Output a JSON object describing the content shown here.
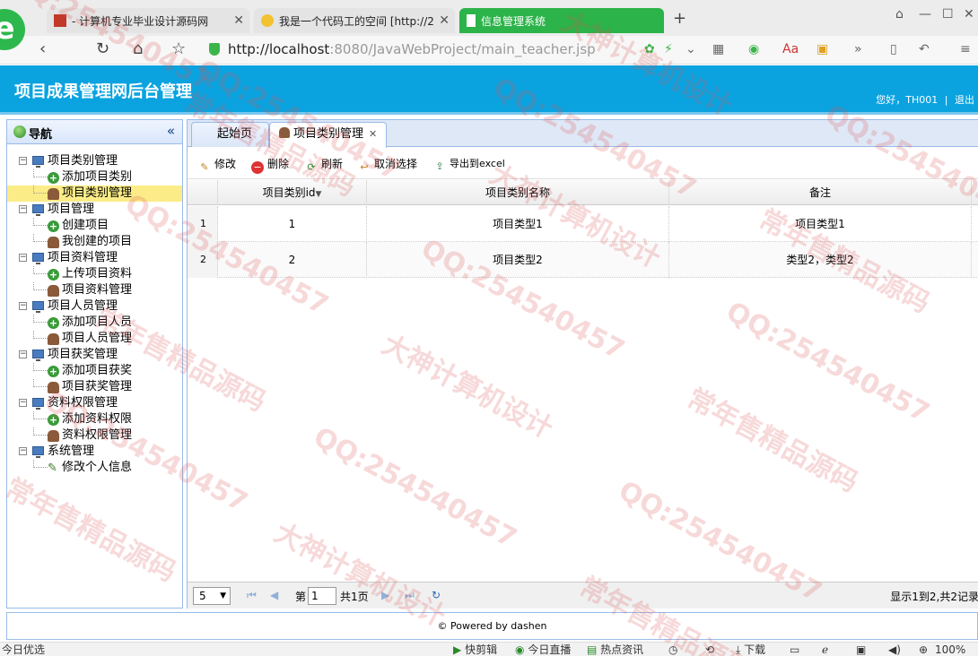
{
  "browser": {
    "tabs": [
      {
        "label": "- 计算机专业毕业设计源码网"
      },
      {
        "label": "我是一个代码工的空间 [http://2"
      },
      {
        "label": "信息管理系统"
      }
    ],
    "url_host": "http://localhost",
    "url_path": ":8080/JavaWebProject/main_teacher.jsp",
    "logo_letter": "e"
  },
  "app": {
    "title": "项目成果管理网后台管理",
    "greeting": "您好，TH001",
    "logout": "退出"
  },
  "sidebar": {
    "title": "导航",
    "groups": [
      {
        "label": "项目类别管理",
        "items": [
          "添加项目类别",
          "项目类别管理"
        ]
      },
      {
        "label": "项目管理",
        "items": [
          "创建项目",
          "我创建的项目"
        ]
      },
      {
        "label": "项目资料管理",
        "items": [
          "上传项目资料",
          "项目资料管理"
        ]
      },
      {
        "label": "项目人员管理",
        "items": [
          "添加项目人员",
          "项目人员管理"
        ]
      },
      {
        "label": "项目获奖管理",
        "items": [
          "添加项目获奖",
          "项目获奖管理"
        ]
      },
      {
        "label": "资料权限管理",
        "items": [
          "添加资料权限",
          "资料权限管理"
        ]
      },
      {
        "label": "系统管理",
        "items": [
          "修改个人信息"
        ]
      }
    ]
  },
  "panel": {
    "tabs": [
      "起始页",
      "项目类别管理"
    ],
    "toolbar": {
      "edit": "修改",
      "delete": "删除",
      "refresh": "刷新",
      "cancel_select": "取消选择",
      "export": "导出到excel"
    },
    "columns": [
      "项目类别id",
      "项目类别名称",
      "备注"
    ],
    "rows": [
      {
        "num": "1",
        "id": "1",
        "name": "项目类型1",
        "note": "项目类型1"
      },
      {
        "num": "2",
        "id": "2",
        "name": "项目类型2",
        "note": "类型2，类型2"
      }
    ],
    "pager": {
      "page_size": "5",
      "page_prefix": "第",
      "page_value": "1",
      "page_total": "共1页",
      "summary": "显示1到2,共2记录"
    }
  },
  "footer": {
    "text": "Powered by dashen"
  },
  "statusbar": {
    "left": "今日优选",
    "items": [
      "快剪辑",
      "今日直播",
      "热点资讯",
      "下载"
    ],
    "zoom": "100%"
  },
  "watermark": {
    "lines": [
      "QQ:254540457",
      "大神计算机设计",
      "常年售精品源码"
    ]
  }
}
